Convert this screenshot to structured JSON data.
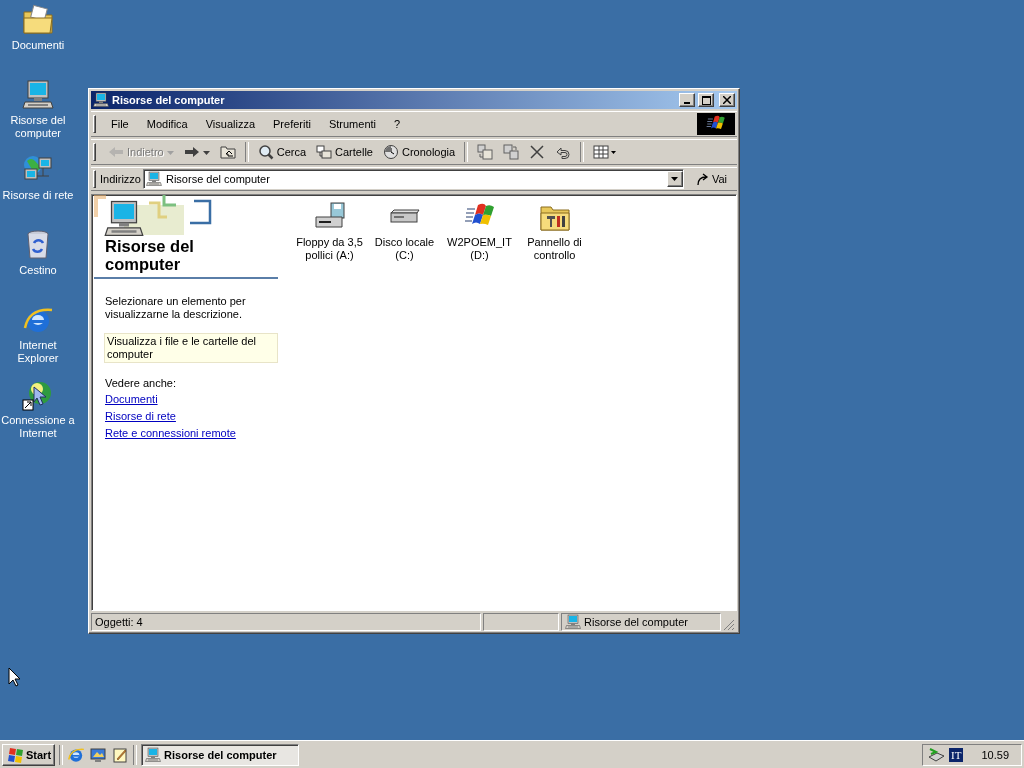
{
  "desktop_icons": [
    {
      "label": "Documenti",
      "kind": "documents"
    },
    {
      "label": "Risorse del computer",
      "kind": "computer"
    },
    {
      "label": "Risorse di rete",
      "kind": "network"
    },
    {
      "label": "Cestino",
      "kind": "recycle"
    },
    {
      "label": "Internet Explorer",
      "kind": "browser"
    },
    {
      "label": "Connessione a Internet",
      "kind": "connect"
    }
  ],
  "window": {
    "title": "Risorse del computer",
    "menu": [
      "File",
      "Modifica",
      "Visualizza",
      "Preferiti",
      "Strumenti",
      "?"
    ],
    "toolbar": [
      {
        "kind": "back",
        "label": "Indietro",
        "disabled": true
      },
      {
        "kind": "forward",
        "disabled": false
      },
      {
        "kind": "up",
        "disabled": false
      },
      {
        "kind": "search",
        "label": "Cerca",
        "disabled": false
      },
      {
        "kind": "folders",
        "label": "Cartelle",
        "disabled": false
      },
      {
        "kind": "history",
        "label": "Cronologia",
        "disabled": false
      },
      {
        "kind": "move",
        "disabled": false
      },
      {
        "kind": "copy",
        "disabled": false
      },
      {
        "kind": "delete",
        "disabled": false
      },
      {
        "kind": "undo",
        "disabled": false
      },
      {
        "kind": "views",
        "disabled": false
      }
    ],
    "address": {
      "label": "Indirizzo",
      "value": "Risorse del computer",
      "go": "Vai"
    },
    "panel": {
      "title": "Risorse del computer",
      "hint": "Selezionare un elemento per visualizzarne la descrizione.",
      "info": "Visualizza i file e le cartelle del computer",
      "see_also": "Vedere anche:",
      "links": [
        "Documenti",
        "Risorse di rete",
        "Rete e connessioni remote"
      ]
    },
    "items": [
      {
        "label": "Floppy da 3,5 pollici (A:)",
        "kind": "floppy"
      },
      {
        "label": "Disco locale (C:)",
        "kind": "disk"
      },
      {
        "label": "W2POEM_IT (D:)",
        "kind": "cd"
      },
      {
        "label": "Pannello di controllo",
        "kind": "control"
      }
    ],
    "status": {
      "objects": "Oggetti: 4",
      "location": "Risorse del computer"
    }
  },
  "taskbar": {
    "start": "Start",
    "quick_launch": [
      {
        "kind": "browser"
      },
      {
        "kind": "desktop"
      },
      {
        "kind": "notepad"
      }
    ],
    "tasks": [
      {
        "label": "Risorse del computer",
        "selected": true
      }
    ],
    "tray": {
      "language": "IT",
      "clock": "10.59"
    }
  }
}
